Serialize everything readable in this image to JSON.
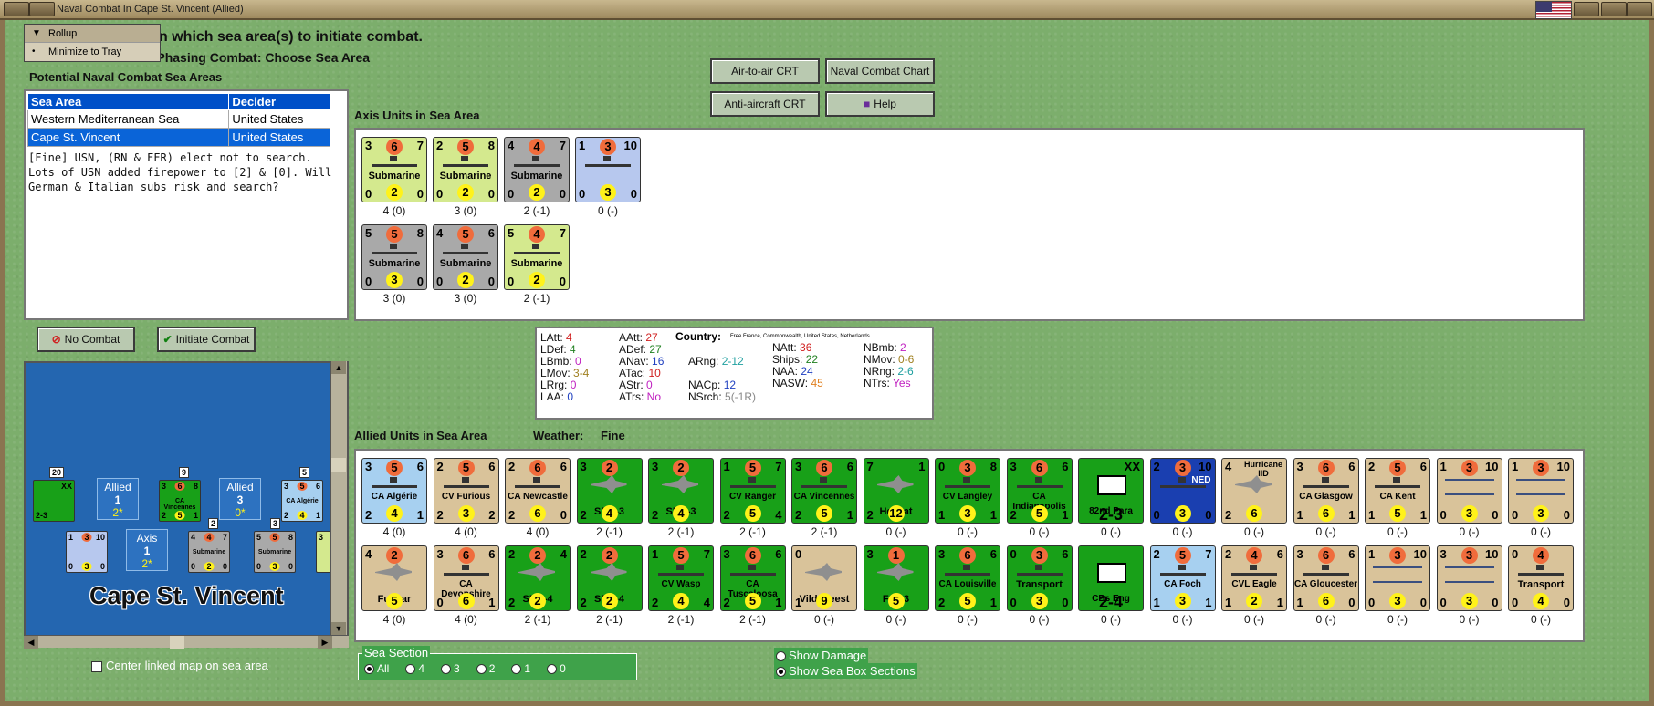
{
  "window": {
    "title": "Naval Combat In Cape St. Vincent (Allied)"
  },
  "menu_popup": {
    "items": [
      "Rollup",
      "Minimize to Tray"
    ],
    "markers": [
      "▼",
      "•"
    ]
  },
  "header": {
    "line1": "n which sea area(s) to initiate combat.",
    "line2": "hase is Phasing Combat: Choose Sea Area",
    "potential_label": "Potential Naval Combat Sea Areas"
  },
  "sea_areas": {
    "headers": [
      "Sea Area",
      "Decider"
    ],
    "rows": [
      [
        "Western Mediterranean Sea",
        "United States"
      ],
      [
        "Cape St. Vincent",
        "United States"
      ]
    ],
    "selected_index": 1,
    "note": "[Fine] USN, (RN & FFR) elect not to search. Lots of USN added firepower to [2] & [0]. Will German & Italian subs risk and search?"
  },
  "buttons": {
    "air_to_air": "Air-to-air CRT",
    "naval_chart": "Naval Combat Chart",
    "anti_aircraft": "Anti-aircraft CRT",
    "help": "Help",
    "no_combat": "No Combat",
    "initiate": "Initiate Combat"
  },
  "axis": {
    "label": "Axis Units in Sea Area",
    "counters": [
      {
        "tl": "3",
        "tm": "6",
        "tr": "7",
        "name": "Submarine",
        "bl": "0",
        "bm": "2",
        "br": "0",
        "caption": "4 (0)",
        "color": "#d4e98e"
      },
      {
        "tl": "2",
        "tm": "5",
        "tr": "8",
        "name": "Submarine",
        "bl": "0",
        "bm": "2",
        "br": "0",
        "caption": "3 (0)",
        "color": "#d4e98e"
      },
      {
        "tl": "4",
        "tm": "4",
        "tr": "7",
        "name": "Submarine",
        "bl": "0",
        "bm": "2",
        "br": "0",
        "caption": "2 (-1)",
        "color": "#a9a9a9"
      },
      {
        "tl": "1",
        "tm": "3",
        "tr": "10",
        "name": "",
        "bl": "0",
        "bm": "3",
        "br": "0",
        "caption": "0 (-)",
        "color": "#b7c8ee"
      },
      {
        "tl": "5",
        "tm": "5",
        "tr": "8",
        "name": "Submarine",
        "bl": "0",
        "bm": "3",
        "br": "0",
        "caption": "3 (0)",
        "color": "#a9a9a9"
      },
      {
        "tl": "4",
        "tm": "5",
        "tr": "6",
        "name": "Submarine",
        "bl": "0",
        "bm": "2",
        "br": "0",
        "caption": "3 (0)",
        "color": "#a9a9a9"
      },
      {
        "tl": "5",
        "tm": "4",
        "tr": "7",
        "name": "Submarine",
        "bl": "0",
        "bm": "2",
        "br": "0",
        "caption": "2 (-1)",
        "color": "#d4e98e"
      }
    ]
  },
  "stats": {
    "country_label": "Country:",
    "country_value": "Free France, Commonwealth, United States, Netherlands",
    "items": [
      {
        "k": "LAtt:",
        "v": "4",
        "c": "#d02020"
      },
      {
        "k": "LDef:",
        "v": "4",
        "c": "#208020"
      },
      {
        "k": "LBmb:",
        "v": "0",
        "c": "#c020c0"
      },
      {
        "k": "LMov:",
        "v": "3-4",
        "c": "#a08020"
      },
      {
        "k": "LRrg:",
        "v": "0",
        "c": "#c020c0"
      },
      {
        "k": "LAA:",
        "v": "0",
        "c": "#2040c0"
      },
      {
        "k": "AAtt:",
        "v": "27",
        "c": "#d02020"
      },
      {
        "k": "ADef:",
        "v": "27",
        "c": "#208020"
      },
      {
        "k": "ANav:",
        "v": "16",
        "c": "#2040c0"
      },
      {
        "k": "ATac:",
        "v": "10",
        "c": "#d02020"
      },
      {
        "k": "AStr:",
        "v": "0",
        "c": "#c020c0"
      },
      {
        "k": "ATrs:",
        "v": "No",
        "c": "#c020c0"
      },
      {
        "k": "ARng:",
        "v": "2-12",
        "c": "#20a0a0"
      },
      {
        "k": "NACp:",
        "v": "12",
        "c": "#2040c0"
      },
      {
        "k": "NSrch:",
        "v": "5(-1R)",
        "c": "#888888"
      },
      {
        "k": "NAtt:",
        "v": "36",
        "c": "#d02020"
      },
      {
        "k": "Ships:",
        "v": "22",
        "c": "#208020"
      },
      {
        "k": "NAA:",
        "v": "24",
        "c": "#2040c0"
      },
      {
        "k": "NASW:",
        "v": "45",
        "c": "#e08020"
      },
      {
        "k": "NBmb:",
        "v": "2",
        "c": "#c020c0"
      },
      {
        "k": "NMov:",
        "v": "0-6",
        "c": "#a08020"
      },
      {
        "k": "NRng:",
        "v": "2-6",
        "c": "#20a0a0"
      },
      {
        "k": "NTrs:",
        "v": "Yes",
        "c": "#c020c0"
      }
    ]
  },
  "allied": {
    "label": "Allied Units in Sea Area",
    "weather_label": "Weather:",
    "weather_value": "Fine",
    "row1": [
      {
        "tl": "3",
        "tm": "5",
        "tr": "6",
        "name": "CA Algérie",
        "bl": "2",
        "bm": "4",
        "br": "1",
        "caption": "4 (0)",
        "color": "#a7d0f0",
        "kind": "ship"
      },
      {
        "tl": "2",
        "tm": "5",
        "tr": "6",
        "name": "CV Furious",
        "bl": "2",
        "bm": "3",
        "br": "2",
        "caption": "4 (0)",
        "color": "#d9c39a",
        "kind": "ship"
      },
      {
        "tl": "2",
        "tm": "6",
        "tr": "6",
        "name": "CA Newcastle",
        "bl": "2",
        "bm": "6",
        "br": "0",
        "caption": "4 (0)",
        "color": "#d9c39a",
        "kind": "ship"
      },
      {
        "tl": "3",
        "tm": "2",
        "tr": "",
        "name": "SBD-3",
        "bl": "2",
        "bm": "4",
        "br": "",
        "caption": "2 (-1)",
        "color": "#18a018",
        "kind": "plane"
      },
      {
        "tl": "3",
        "tm": "2",
        "tr": "",
        "name": "SBD-3",
        "bl": "2",
        "bm": "4",
        "br": "",
        "caption": "2 (-1)",
        "color": "#18a018",
        "kind": "plane"
      },
      {
        "tl": "1",
        "tm": "5",
        "tr": "7",
        "name": "CV Ranger",
        "bl": "2",
        "bm": "5",
        "br": "4",
        "caption": "2 (-1)",
        "color": "#18a018",
        "kind": "ship"
      },
      {
        "tl": "3",
        "tm": "6",
        "tr": "6",
        "name": "CA Vincennes",
        "bl": "2",
        "bm": "5",
        "br": "1",
        "caption": "2 (-1)",
        "color": "#18a018",
        "kind": "ship"
      },
      {
        "tl": "7",
        "tm": "",
        "tr": "1",
        "name": "Hellcat",
        "bl": "2",
        "bm": "12",
        "br": "",
        "caption": "0 (-)",
        "color": "#18a018",
        "kind": "plane"
      },
      {
        "tl": "0",
        "tm": "3",
        "tr": "8",
        "name": "CV Langley",
        "bl": "1",
        "bm": "3",
        "br": "1",
        "caption": "0 (-)",
        "color": "#18a018",
        "kind": "ship"
      },
      {
        "tl": "3",
        "tm": "6",
        "tr": "6",
        "name": "CA Indianapolis",
        "bl": "2",
        "bm": "5",
        "br": "1",
        "caption": "0 (-)",
        "color": "#18a018",
        "kind": "ship"
      },
      {
        "tl": "",
        "tm": "",
        "tr": "XX",
        "name": "82nd Para",
        "bl": "",
        "bm": "2-3",
        "br": "",
        "caption": "0 (-)",
        "color": "#18a018",
        "kind": "land"
      },
      {
        "tl": "2",
        "tm": "3",
        "tr": "10",
        "name": "NED",
        "bl": "0",
        "bm": "3",
        "br": "0",
        "caption": "0 (-)",
        "color": "#1a3fb0",
        "kind": "ship"
      },
      {
        "tl": "4",
        "tm": "",
        "tr": "Hurricane IID",
        "name": "",
        "bl": "2",
        "bm": "6",
        "br": "",
        "caption": "0 (-)",
        "color": "#d9c39a",
        "kind": "plane"
      },
      {
        "tl": "3",
        "tm": "6",
        "tr": "6",
        "name": "CA Glasgow",
        "bl": "1",
        "bm": "6",
        "br": "1",
        "caption": "0 (-)",
        "color": "#d9c39a",
        "kind": "ship"
      },
      {
        "tl": "2",
        "tm": "5",
        "tr": "6",
        "name": "CA Kent",
        "bl": "1",
        "bm": "5",
        "br": "1",
        "caption": "0 (-)",
        "color": "#d9c39a",
        "kind": "ship"
      },
      {
        "tl": "1",
        "tm": "3",
        "tr": "10",
        "name": "",
        "bl": "0",
        "bm": "3",
        "br": "0",
        "caption": "0 (-)",
        "color": "#d9c39a",
        "kind": "stack"
      },
      {
        "tl": "1",
        "tm": "3",
        "tr": "10",
        "name": "",
        "bl": "0",
        "bm": "3",
        "br": "0",
        "caption": "0 (-)",
        "color": "#d9c39a",
        "kind": "stack"
      }
    ],
    "row2": [
      {
        "tl": "4",
        "tm": "2",
        "tr": "",
        "name": "Fulmar",
        "bl": "",
        "bm": "5",
        "br": "",
        "caption": "4 (0)",
        "color": "#d9c39a",
        "kind": "plane"
      },
      {
        "tl": "3",
        "tm": "6",
        "tr": "6",
        "name": "CA Devonshire",
        "bl": "0",
        "bm": "6",
        "br": "1",
        "caption": "4 (0)",
        "color": "#d9c39a",
        "kind": "ship"
      },
      {
        "tl": "2",
        "tm": "2",
        "tr": "4",
        "name": "SBD-4",
        "bl": "2",
        "bm": "2",
        "br": "",
        "caption": "2 (-1)",
        "color": "#18a018",
        "kind": "plane"
      },
      {
        "tl": "2",
        "tm": "2",
        "tr": "",
        "name": "SBD-4",
        "bl": "2",
        "bm": "2",
        "br": "",
        "caption": "2 (-1)",
        "color": "#18a018",
        "kind": "plane"
      },
      {
        "tl": "1",
        "tm": "5",
        "tr": "7",
        "name": "CV Wasp",
        "bl": "2",
        "bm": "4",
        "br": "4",
        "caption": "2 (-1)",
        "color": "#18a018",
        "kind": "ship"
      },
      {
        "tl": "3",
        "tm": "6",
        "tr": "6",
        "name": "CA Tuscaloosa",
        "bl": "2",
        "bm": "5",
        "br": "1",
        "caption": "2 (-1)",
        "color": "#18a018",
        "kind": "ship"
      },
      {
        "tl": "0",
        "tm": "",
        "tr": "",
        "name": "Vildebeest",
        "bl": "1",
        "bm": "9",
        "br": "",
        "caption": "0 (-)",
        "color": "#d9c39a",
        "kind": "plane"
      },
      {
        "tl": "3",
        "tm": "1",
        "tr": "",
        "name": "F4F-3",
        "bl": "",
        "bm": "5",
        "br": "",
        "caption": "0 (-)",
        "color": "#18a018",
        "kind": "plane"
      },
      {
        "tl": "3",
        "tm": "6",
        "tr": "6",
        "name": "CA Louisville",
        "bl": "2",
        "bm": "5",
        "br": "1",
        "caption": "0 (-)",
        "color": "#18a018",
        "kind": "ship"
      },
      {
        "tl": "0",
        "tm": "3",
        "tr": "6",
        "name": "Transport",
        "bl": "0",
        "bm": "3",
        "br": "0",
        "caption": "0 (-)",
        "color": "#18a018",
        "kind": "ship"
      },
      {
        "tl": "",
        "tm": "",
        "tr": "",
        "name": "CBs Eng",
        "bl": "",
        "bm": "2-4",
        "br": "",
        "caption": "0 (-)",
        "color": "#18a018",
        "kind": "land"
      },
      {
        "tl": "2",
        "tm": "5",
        "tr": "7",
        "name": "CA Foch",
        "bl": "1",
        "bm": "3",
        "br": "1",
        "caption": "0 (-)",
        "color": "#a7d0f0",
        "kind": "ship"
      },
      {
        "tl": "2",
        "tm": "4",
        "tr": "6",
        "name": "CVL Eagle",
        "bl": "1",
        "bm": "2",
        "br": "1",
        "caption": "0 (-)",
        "color": "#d9c39a",
        "kind": "ship"
      },
      {
        "tl": "3",
        "tm": "6",
        "tr": "6",
        "name": "CA Gloucester",
        "bl": "1",
        "bm": "6",
        "br": "0",
        "caption": "0 (-)",
        "color": "#d9c39a",
        "kind": "ship"
      },
      {
        "tl": "1",
        "tm": "3",
        "tr": "10",
        "name": "",
        "bl": "0",
        "bm": "3",
        "br": "0",
        "caption": "0 (-)",
        "color": "#d9c39a",
        "kind": "stack"
      },
      {
        "tl": "3",
        "tm": "3",
        "tr": "10",
        "name": "",
        "bl": "0",
        "bm": "3",
        "br": "0",
        "caption": "0 (-)",
        "color": "#d9c39a",
        "kind": "stack"
      },
      {
        "tl": "0",
        "tm": "4",
        "tr": "",
        "name": "Transport",
        "bl": "0",
        "bm": "4",
        "br": "0",
        "caption": "0 (-)",
        "color": "#d9c39a",
        "kind": "ship"
      }
    ]
  },
  "map": {
    "title": "Cape St. Vincent",
    "boxes": [
      {
        "label": "Allied",
        "n": "1",
        "s": "2*"
      },
      {
        "label": "Allied",
        "n": "3",
        "s": "0*"
      },
      {
        "label": "Axis",
        "n": "1",
        "s": "2*"
      }
    ],
    "stack_counts": [
      "20",
      "9",
      "5",
      "2",
      "3"
    ],
    "mini_counters": [
      {
        "a": "",
        "b": "XX",
        "c": "2-3",
        "d": "",
        "e": "",
        "f": "",
        "nm": "",
        "color": "#18a018"
      },
      {
        "a": "3",
        "b": "8",
        "c": "2",
        "d": "1",
        "e": "6",
        "f": "5",
        "nm": "CA Vincennes",
        "color": "#18a018"
      },
      {
        "a": "3",
        "b": "6",
        "c": "2",
        "d": "1",
        "e": "5",
        "f": "4",
        "nm": "CA Algérie",
        "color": "#a7d0f0"
      },
      {
        "a": "1",
        "b": "10",
        "c": "0",
        "d": "0",
        "e": "3",
        "f": "3",
        "nm": "",
        "color": "#b7c8ee"
      },
      {
        "a": "4",
        "b": "7",
        "c": "0",
        "d": "0",
        "e": "4",
        "f": "2",
        "nm": "Submarine",
        "color": "#a9a9a9"
      },
      {
        "a": "5",
        "b": "8",
        "c": "0",
        "d": "0",
        "e": "5",
        "f": "3",
        "nm": "Submarine",
        "color": "#a9a9a9"
      },
      {
        "a": "3",
        "b": "",
        "c": "",
        "d": "",
        "e": "",
        "f": "",
        "nm": "",
        "color": "#d4e98e"
      }
    ]
  },
  "options": {
    "center_linked": "Center linked map on sea area",
    "sea_section_label": "Sea Section",
    "sea_section_opts": [
      "All",
      "4",
      "3",
      "2",
      "1",
      "0"
    ],
    "sea_section_selected": 0,
    "show_damage": "Show Damage",
    "show_sea_box": "Show Sea Box Sections"
  }
}
